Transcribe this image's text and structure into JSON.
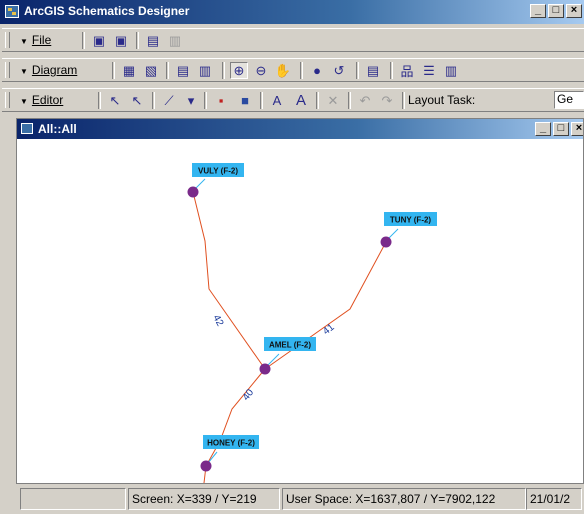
{
  "window": {
    "title": "ArcGIS Schematics Designer"
  },
  "toolbars": {
    "file": {
      "label": "File"
    },
    "diagram": {
      "label": "Diagram"
    },
    "editor": {
      "label": "Editor",
      "layout_task_label": "Layout Task:",
      "layout_task_value": "Ge"
    }
  },
  "document": {
    "title": "All::All"
  },
  "diagram": {
    "nodes": [
      {
        "label": "VULY (F-2)",
        "icon": "network-node-icon"
      },
      {
        "label": "TUNY (F-2)",
        "icon": "network-node-icon"
      },
      {
        "label": "AMEL (F-2)",
        "icon": "network-node-icon"
      },
      {
        "label": "HONEY (F-2)",
        "icon": "network-node-icon"
      }
    ],
    "links": [
      {
        "label": "42",
        "from": "VULY (F-2)",
        "to": "AMEL (F-2)"
      },
      {
        "label": "41",
        "from": "TUNY (F-2)",
        "to": "AMEL (F-2)"
      },
      {
        "label": "40",
        "from": "AMEL (F-2)",
        "to": "HONEY (F-2)"
      }
    ],
    "colors": {
      "link": "#e05020",
      "node": "#7a2a8a",
      "label_bg": "#33b5f0",
      "link_label": "#1a3a9a"
    }
  },
  "status": {
    "screen": "Screen: X=339 / Y=219",
    "user_space": "User Space: X=1637,807 / Y=7902,122",
    "date": "21/01/2"
  }
}
